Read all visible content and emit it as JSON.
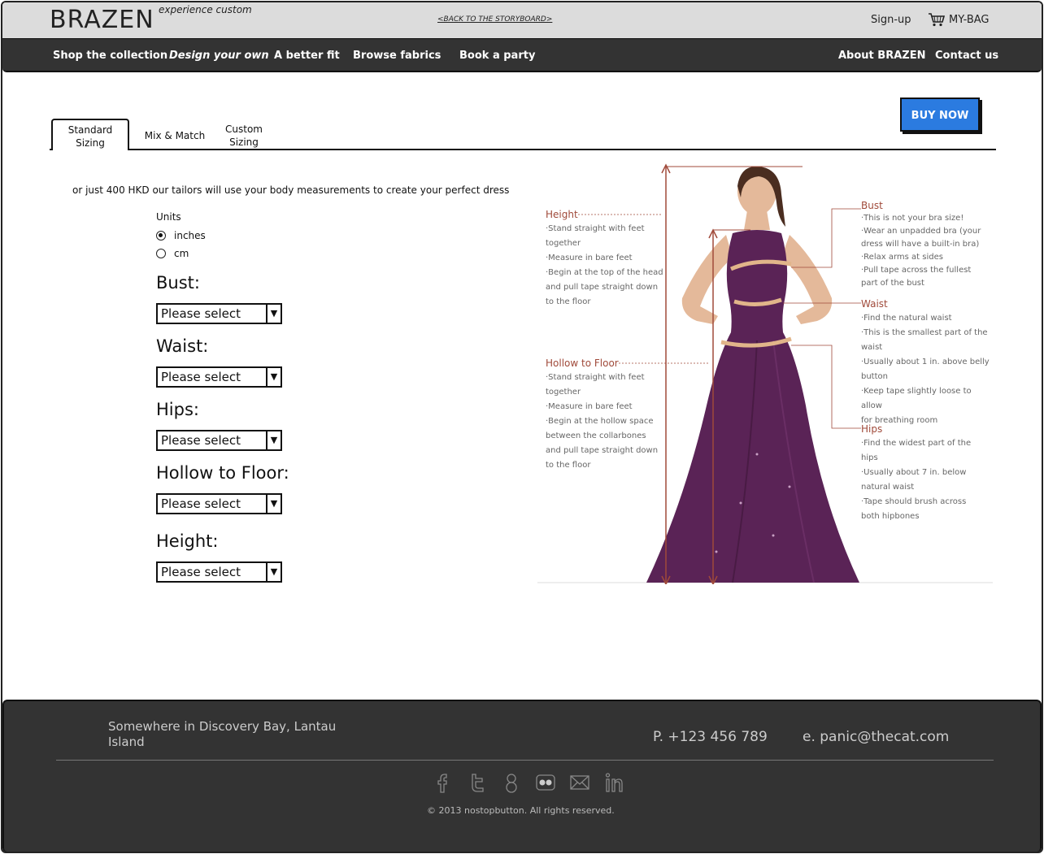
{
  "header": {
    "logo": "BRAZEN",
    "tagline": "experience custom",
    "storyboard_link": "<BACK TO THE STORYBOARD>",
    "signup": "Sign-up",
    "bag": "MY-BAG"
  },
  "nav": {
    "items": [
      "Shop the collection",
      "Design your own",
      "A better fit",
      "Browse fabrics",
      "Book a party"
    ],
    "right": [
      "About BRAZEN",
      "Contact us"
    ]
  },
  "tabs": {
    "standard": "Standard\nSizing",
    "standard_l1": "Standard",
    "standard_l2": "Sizing",
    "mix": "Mix & Match",
    "custom_l1": "Custom",
    "custom_l2": "Sizing"
  },
  "buy_now": "BUY NOW",
  "intro": "or just 400 HKD our tailors will use your body measurements to create your perfect dress",
  "units": {
    "label": "Units",
    "options": [
      "inches",
      "cm"
    ],
    "selected": "inches"
  },
  "fields": [
    {
      "label": "Bust:",
      "value": "Please select"
    },
    {
      "label": "Waist:",
      "value": "Please select"
    },
    {
      "label": "Hips:",
      "value": "Please select"
    },
    {
      "label": "Hollow to Floor:",
      "value": "Please select"
    },
    {
      "label": "Height:",
      "value": "Please select"
    }
  ],
  "diagram": {
    "height": {
      "title": "Height",
      "lines": [
        "·Stand straight with feet",
        "together",
        "·Measure in bare feet",
        "·Begin at the top of the head",
        "and pull tape straight down",
        "to the floor"
      ]
    },
    "hollow": {
      "title": "Hollow to Floor",
      "lines": [
        "·Stand straight with feet",
        "together",
        "·Measure in bare feet",
        "·Begin at the hollow space",
        "between the collarbones",
        "and pull tape straight down",
        "to the floor"
      ]
    },
    "bust": {
      "title": "Bust",
      "lines": [
        "·This is not your bra size!",
        "·Wear an unpadded bra (your",
        "dress will have a built-in bra)",
        "·Relax arms at sides",
        "·Pull tape across the fullest",
        "part of the bust"
      ]
    },
    "waist": {
      "title": "Waist",
      "lines": [
        "·Find the natural waist",
        "·This is the smallest part of the",
        "waist",
        "·Usually about 1 in. above belly",
        "button",
        "·Keep tape slightly loose to allow",
        "for breathing room"
      ]
    },
    "hips": {
      "title": "Hips",
      "lines": [
        "·Find the widest part of the",
        "hips",
        "·Usually about 7 in. below",
        "natural waist",
        "·Tape should brush across",
        "both hipbones"
      ]
    }
  },
  "footer": {
    "address": "Somewhere in Discovery Bay, Lantau Island",
    "phone": "P. +123 456 789",
    "email": "e. panic@thecat.com",
    "social": [
      "facebook-icon",
      "twitter-icon",
      "googleplus-icon",
      "flickr-icon",
      "mail-icon",
      "linkedin-icon"
    ],
    "copyright": "© 2013 nostopbutton. All rights reserved."
  },
  "colors": {
    "accent": "#2b7be0",
    "nav_bg": "#333333",
    "topbar_bg": "#dcdcdc",
    "dress": "#5a2356",
    "annotation": "#a04a3a"
  }
}
